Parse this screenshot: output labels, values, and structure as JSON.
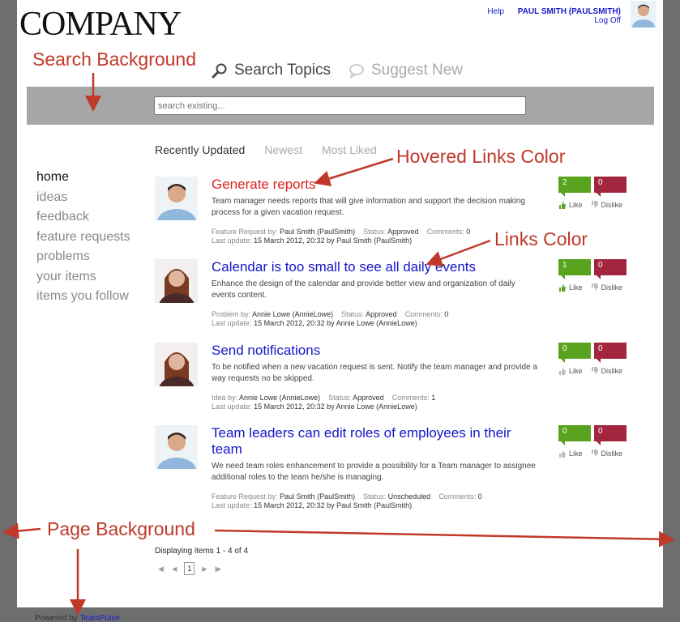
{
  "header": {
    "logo": "COMPANY",
    "help": "Help",
    "user": "PAUL SMITH (PAULSMITH)",
    "logoff": "Log Off"
  },
  "search_tabs": [
    "Search Topics",
    "Suggest New"
  ],
  "search": {
    "placeholder": "search existing..."
  },
  "sidebar": {
    "items": [
      "home",
      "ideas",
      "feedback",
      "feature requests",
      "problems",
      "your items",
      "items you follow"
    ]
  },
  "sort_tabs": [
    "Recently Updated",
    "Newest",
    "Most Liked"
  ],
  "items": [
    {
      "title": "Generate reports",
      "desc": "Team manager needs reports that will give information and support the decision making process for a given vacation request.",
      "type_label": "Feature Request by:",
      "author": "Paul Smith (PaulSmith)",
      "status_label": "Status:",
      "status": "Approved",
      "comments_label": "Comments:",
      "comments": "0",
      "update_label": "Last update:",
      "update": "15 March 2012, 20:32 by Paul Smith (PaulSmith)",
      "likes": "2",
      "dislikes": "0"
    },
    {
      "title": "Calendar is too small to see all daily events",
      "desc": "Enhance the design of the calendar and provide better view and organization of daily events content.",
      "type_label": "Problem by:",
      "author": "Annie Lowe (AnnieLowe)",
      "status_label": "Status:",
      "status": "Approved",
      "comments_label": "Comments:",
      "comments": "0",
      "update_label": "Last update:",
      "update": "15 March 2012, 20:32 by Annie Lowe (AnnieLowe)",
      "likes": "1",
      "dislikes": "0"
    },
    {
      "title": "Send notifications",
      "desc": "To be notified when a new vacation request is sent. Notify the team manager and provide a way requests no be skipped.",
      "type_label": "Idea by:",
      "author": "Annie Lowe (AnnieLowe)",
      "status_label": "Status:",
      "status": "Approved",
      "comments_label": "Comments:",
      "comments": "1",
      "update_label": "Last update:",
      "update": "15 March 2012, 20:32 by Annie Lowe (AnnieLowe)",
      "likes": "0",
      "dislikes": "0"
    },
    {
      "title": "Team leaders can edit roles of employees in their team",
      "desc": "We need team roles enhancement to provide a possibility for a Team manager to assignee additional roles to the team he/she is managing.",
      "type_label": "Feature Request by:",
      "author": "Paul Smith (PaulSmith)",
      "status_label": "Status:",
      "status": "Unscheduled",
      "comments_label": "Comments:",
      "comments": "0",
      "update_label": "Last update:",
      "update": "15 March 2012, 20:32 by Paul Smith (PaulSmith)",
      "likes": "0",
      "dislikes": "0"
    }
  ],
  "vote_labels": {
    "like": "Like",
    "dislike": "Dislike"
  },
  "footer": {
    "displaying": "Displaying items 1 - 4 of 4",
    "page": "1",
    "powered": "Powered by",
    "powered_link": "TeamPulse"
  },
  "annotations": {
    "search_bg": "Search Background",
    "hovered": "Hovered Links Color",
    "links": "Links Color",
    "page_bg": "Page Background"
  },
  "colors": {
    "link": "#1515c8",
    "hovered_link": "#dd2020",
    "search_bg": "#a6a6a6",
    "page_bg": "#6e6e6e",
    "like": "#5aa31f",
    "dislike": "#a3263f",
    "annotation": "#c0392b"
  }
}
